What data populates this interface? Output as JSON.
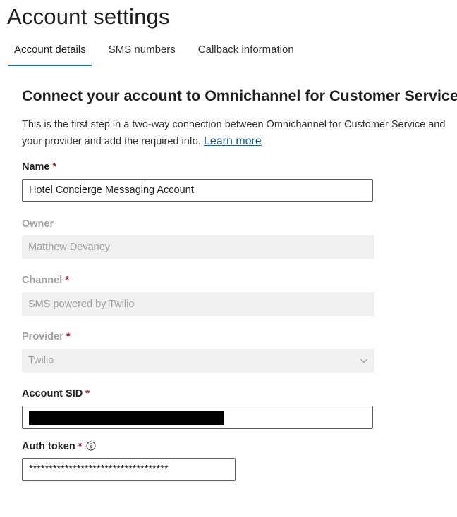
{
  "page": {
    "title": "Account settings"
  },
  "tabs": [
    {
      "label": "Account details",
      "active": true
    },
    {
      "label": "SMS numbers",
      "active": false
    },
    {
      "label": "Callback information",
      "active": false
    }
  ],
  "section": {
    "title": "Connect your account to Omnichannel for Customer Service",
    "description_line1": "This is the first step in a two-way connection between Omnichannel for Customer Service and",
    "description_line2": "your provider and add the required info.",
    "learn_more": "Learn more"
  },
  "form": {
    "name": {
      "label": "Name",
      "required_mark": "*",
      "value": "Hotel Concierge Messaging Account"
    },
    "owner": {
      "label": "Owner",
      "value": "Matthew Devaney"
    },
    "channel": {
      "label": "Channel",
      "required_mark": "*",
      "value": "SMS powered by Twilio"
    },
    "provider": {
      "label": "Provider",
      "required_mark": "*",
      "value": "Twilio"
    },
    "account_sid": {
      "label": "Account SID",
      "required_mark": "*",
      "redacted": true
    },
    "auth_token": {
      "label": "Auth token",
      "required_mark": "*",
      "value": "***********************************",
      "info_icon": "info-icon"
    }
  },
  "colors": {
    "accent": "#0f6cbd",
    "link": "#115ea3",
    "required": "#a4262c",
    "disabled_bg": "#f0f0f0",
    "disabled_text": "#a19f9d"
  }
}
